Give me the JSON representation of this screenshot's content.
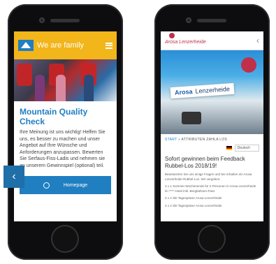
{
  "left_phone": {
    "header_title": "We are family",
    "heading": "Mountain Quality Check",
    "body": "Ihre Meinung ist uns wichtig! Helfen Sie uns, es besser zu machen und unser Angebot auf Ihre Wünsche und Anforderungen anzupassen. Bewerten Sie Serfaus-Fiss-Ladis und nehmen sie an unserem Gewinnspiel (optional) teil.",
    "homepage_button": "Homepage",
    "back_glyph": "‹"
  },
  "right_phone": {
    "logo_text": "Arosa Lenzerheide",
    "back_glyph": "‹",
    "sign_brand": "Arosa",
    "sign_text": "Lenzerheide",
    "breadcrumb_start": "START »",
    "breadcrumb_rest": "ATTRIBUTEN ZAHLA LOS",
    "language": "Deutsch",
    "heading": "Sofort gewinnen beim Feedback Rubbel-Los 2018/19!",
    "intro": "Beantworten Sie uns einige Fragen und Sie erhalten ein Arosa Lenzerheide Rubbel-Los. Wir vergeben:",
    "prizes": [
      "3 x 1 Sommer-Wochenende für 2 Personen in Arosa Lenzerheide im ****-Hotel inkl. Bergbahnen-Pass",
      "3 x 2 Ski-Tagespässe Arosa Lenzerheide",
      "3 x 2 Ski-Tagespässe Arosa Lenzerheide"
    ]
  },
  "colors": {
    "yellow": "#f2b51a",
    "blue": "#1f7fc1"
  }
}
